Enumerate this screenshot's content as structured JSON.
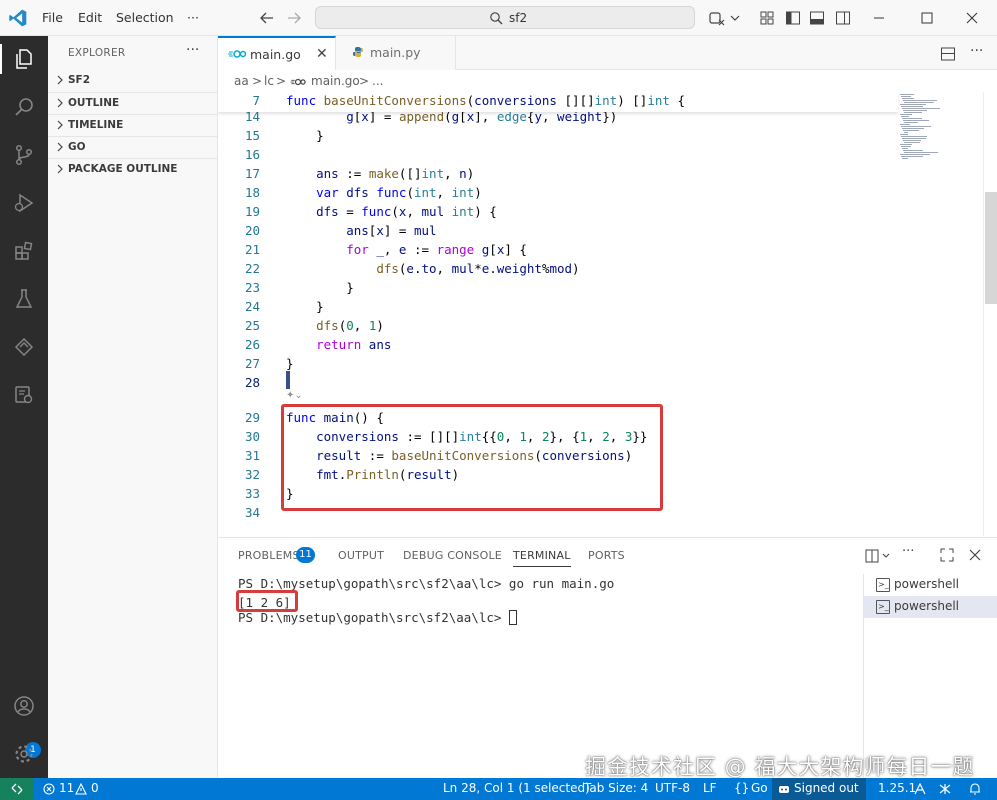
{
  "titlebar": {
    "menu": [
      "File",
      "Edit",
      "Selection",
      "···"
    ],
    "search": "sf2"
  },
  "sidebar": {
    "title": "EXPLORER",
    "more": "···",
    "sections": [
      "SF2",
      "OUTLINE",
      "TIMELINE",
      "GO",
      "PACKAGE OUTLINE"
    ]
  },
  "activity": {
    "account_badge": "1"
  },
  "tabs": [
    {
      "label": "main.go",
      "icon": "go-file-icon",
      "active": true
    },
    {
      "label": "main.py",
      "icon": "python-file-icon",
      "active": false
    }
  ],
  "breadcrumb": [
    "aa",
    ">",
    "lc",
    ">",
    "main.go",
    ">",
    "..."
  ],
  "editor": {
    "sticky_line": {
      "num": "7",
      "text": "func baseUnitConversions(conversions [][]int) []int {"
    },
    "lines": [
      {
        "num": "14",
        "text": "        g[x] = append(g[x], edge{y, weight})"
      },
      {
        "num": "15",
        "text": "    }"
      },
      {
        "num": "16",
        "text": ""
      },
      {
        "num": "17",
        "text": "    ans := make([]int, n)"
      },
      {
        "num": "18",
        "text": "    var dfs func(int, int)"
      },
      {
        "num": "19",
        "text": "    dfs = func(x, mul int) {"
      },
      {
        "num": "20",
        "text": "        ans[x] = mul"
      },
      {
        "num": "21",
        "text": "        for _, e := range g[x] {"
      },
      {
        "num": "22",
        "text": "            dfs(e.to, mul*e.weight%mod)"
      },
      {
        "num": "23",
        "text": "        }"
      },
      {
        "num": "24",
        "text": "    }"
      },
      {
        "num": "25",
        "text": "    dfs(0, 1)"
      },
      {
        "num": "26",
        "text": "    return ans"
      },
      {
        "num": "27",
        "text": "}"
      },
      {
        "num": "28",
        "text": ""
      },
      {
        "num": "29",
        "text": "func main() {"
      },
      {
        "num": "30",
        "text": "    conversions := [][]int{{0, 1, 2}, {1, 2, 3}}"
      },
      {
        "num": "31",
        "text": "    result := baseUnitConversions(conversions)"
      },
      {
        "num": "32",
        "text": "    fmt.Println(result)"
      },
      {
        "num": "33",
        "text": "}"
      },
      {
        "num": "34",
        "text": ""
      }
    ]
  },
  "panel": {
    "tabs": [
      "PROBLEMS",
      "OUTPUT",
      "DEBUG CONSOLE",
      "TERMINAL",
      "PORTS"
    ],
    "problems_count": "11",
    "terminal": [
      "PS D:\\mysetup\\gopath\\src\\sf2\\aa\\lc> go run main.go",
      "[1 2 6]",
      "PS D:\\mysetup\\gopath\\src\\sf2\\aa\\lc> "
    ],
    "terminal_list": [
      "powershell",
      "powershell"
    ],
    "watermark": "掘金技术社区 @ 福大大架构师每日一题"
  },
  "statusbar": {
    "errors": "11",
    "warnings": "0",
    "position": "Ln 28, Col 1 (1 selected)",
    "tab_size": "Tab Size: 4",
    "encoding": "UTF-8",
    "eol": "LF",
    "language": "Go",
    "account": "Signed out",
    "go_version": "1.25.1"
  },
  "colors": {
    "accent": "#0078d4",
    "highlight": "#d83b3b",
    "activitybar": "#2c2c2c",
    "remote": "#16825d"
  }
}
